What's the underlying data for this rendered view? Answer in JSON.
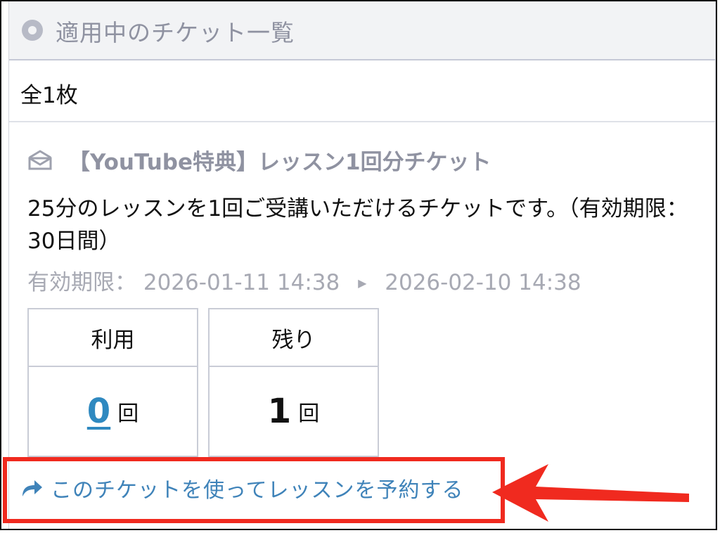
{
  "header": {
    "title": "適用中のチケット一覧",
    "icon": "radio-icon"
  },
  "summary": {
    "count_text": "全1枚"
  },
  "ticket": {
    "icon": "ticket-icon",
    "title": "【YouTube特典】レッスン1回分チケット",
    "description": "25分のレッスンを1回ご受講いただけるチケットです。（有効期限：30日間）",
    "validity_label": "有効期限：",
    "validity_start": "2026-01-11 14:38",
    "validity_end": "2026-02-10 14:38",
    "usage": {
      "used_label": "利用",
      "remaining_label": "残り",
      "used_count": "0",
      "remaining_count": "1",
      "unit": "回"
    },
    "book_link": {
      "label": "このチケットを使ってレッスンを予約する",
      "icon": "share-arrow-icon"
    }
  },
  "annotation": {
    "highlight_color": "#f02a1f"
  },
  "colors": {
    "link": "#2f89c0",
    "muted": "#8f92a1",
    "header_bg": "#f2f3f5"
  }
}
